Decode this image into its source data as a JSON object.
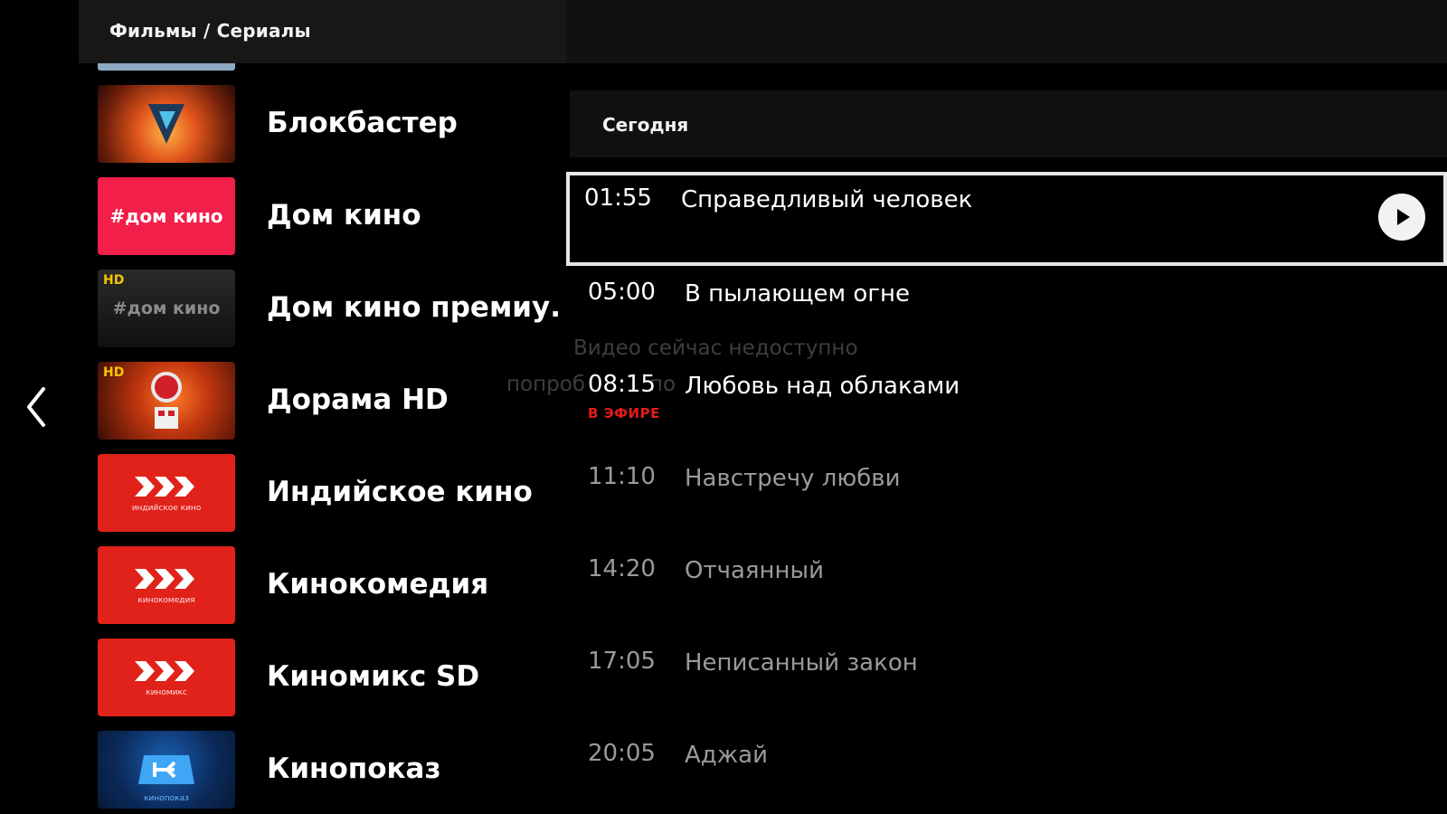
{
  "header": {
    "breadcrumb": "Фильмы / Сериалы"
  },
  "nav": {
    "back_icon": "chevron-left-icon"
  },
  "channels": [
    {
      "name": "Блокбастер",
      "logo": "blockbuster-logo"
    },
    {
      "name": "Дом кино",
      "logo_text": "#дом кино"
    },
    {
      "name": "Дом кино премиу...",
      "badge": "HD",
      "logo_text": "#дом кино"
    },
    {
      "name": "Дорама HD",
      "badge": "HD",
      "logo": "dorama-logo"
    },
    {
      "name": "Индийское кино",
      "logo_sub": "индийское кино"
    },
    {
      "name": "Кинокомедия",
      "logo_sub": "кинокомедия"
    },
    {
      "name": "Киномикс SD",
      "logo_sub": "киномикс"
    },
    {
      "name": "Кинопоказ",
      "logo_sub": "кинопоказ"
    }
  ],
  "schedule": {
    "day": "Сегодня",
    "programs": [
      {
        "time": "01:55",
        "title": "Справедливый человек",
        "state": "selected"
      },
      {
        "time": "05:00",
        "title": "В пылающем огне",
        "state": "past"
      },
      {
        "time": "08:15",
        "title": "Любовь над облаками",
        "state": "live",
        "live_label": "В ЭФИРЕ"
      },
      {
        "time": "11:10",
        "title": "Навстречу любви",
        "state": "future"
      },
      {
        "time": "14:20",
        "title": "Отчаянный",
        "state": "future"
      },
      {
        "time": "17:05",
        "title": "Неписанный закон",
        "state": "future"
      },
      {
        "time": "20:05",
        "title": "Аджай",
        "state": "future"
      }
    ]
  },
  "overlay": {
    "line1": "Видео сейчас недоступно",
    "line2_part1": "попроб",
    "line2_part2": "по"
  },
  "colors": {
    "background": "#000000",
    "live": "#e51b1b",
    "accent_red": "#e0221b",
    "dom_kino_pink": "#f21f4a",
    "selection_border": "#e6e6e6"
  }
}
